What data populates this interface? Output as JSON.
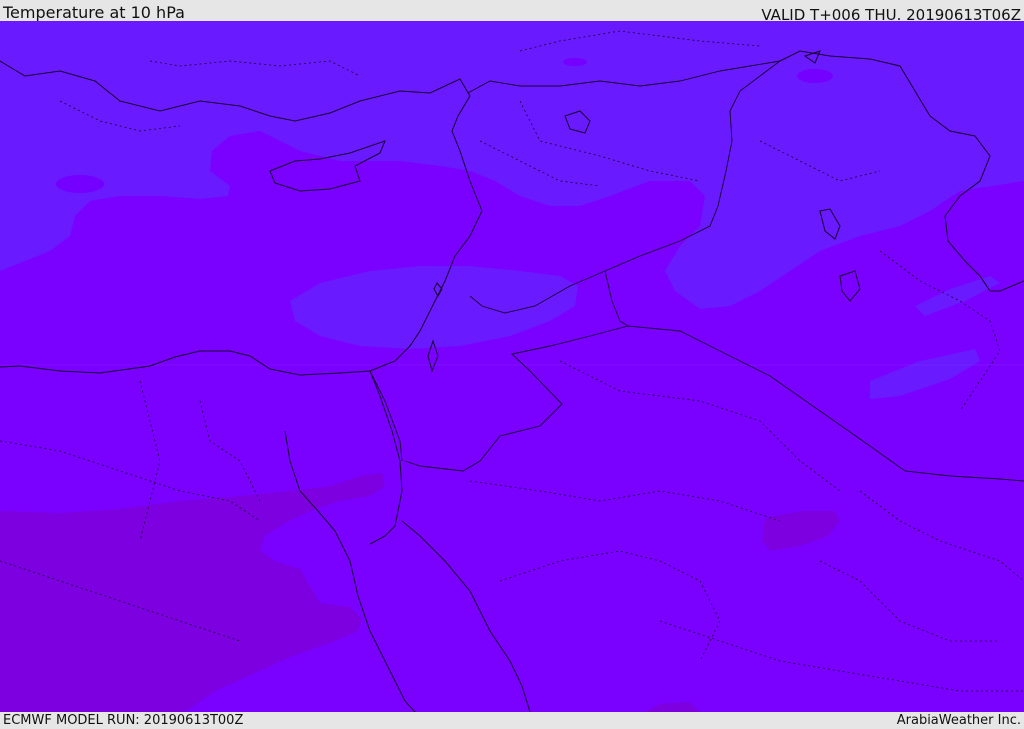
{
  "header": {
    "title": "Temperature at 10 hPa",
    "valid": "VALID T+006 THU. 20190613T06Z"
  },
  "footer": {
    "model_run": "ECMWF MODEL RUN: 20190613T00Z",
    "credit": "ArabiaWeather Inc."
  },
  "map": {
    "field": "temperature",
    "palette": {
      "base": "#7a00ff",
      "cool_band": "#6a1aff",
      "warm_band": "#7d00e0",
      "border": "#1a0030"
    }
  }
}
